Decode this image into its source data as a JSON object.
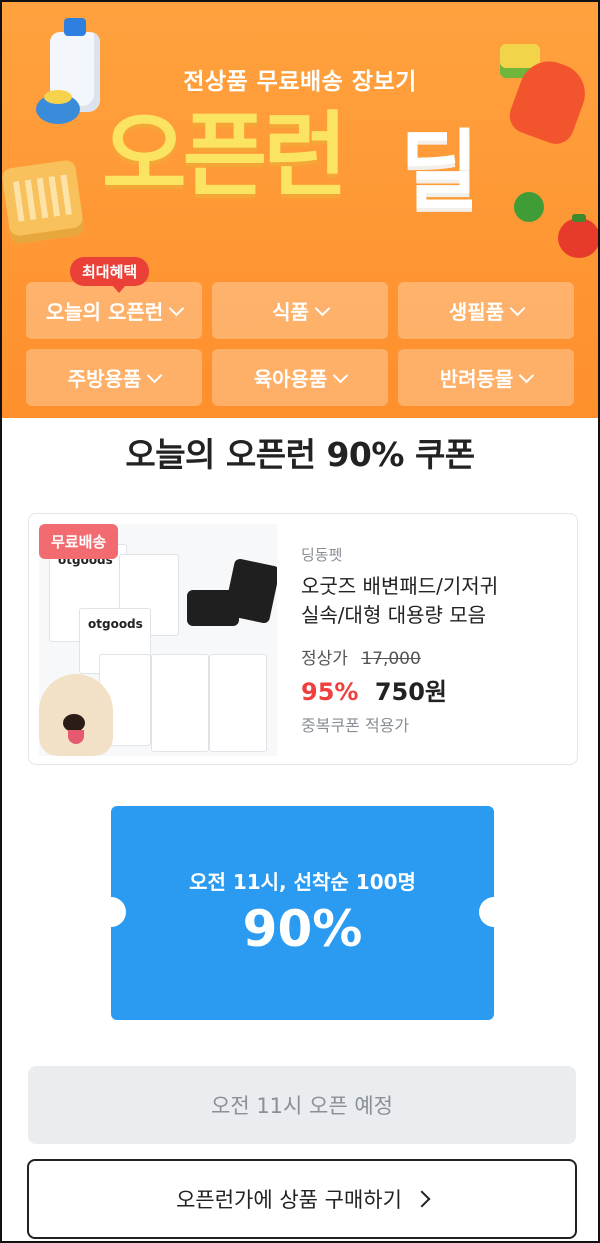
{
  "banner": {
    "subtitle": "전상품 무료배송 장보기",
    "title_main": "오픈런",
    "title_suffix": "딜",
    "badge": "최대혜택",
    "bg_color": "#fe9a35"
  },
  "categories": [
    {
      "label": "오늘의 오픈런",
      "icon": "chevron-down-icon"
    },
    {
      "label": "식품",
      "icon": "chevron-down-icon"
    },
    {
      "label": "생필품",
      "icon": "chevron-down-icon"
    },
    {
      "label": "주방용품",
      "icon": "chevron-down-icon"
    },
    {
      "label": "육아용품",
      "icon": "chevron-down-icon"
    },
    {
      "label": "반려동물",
      "icon": "chevron-down-icon"
    }
  ],
  "section": {
    "title": "오늘의 오픈런 90% 쿠폰"
  },
  "product": {
    "tag": "무료배송",
    "brand": "딩동펫",
    "name_line1": "오굿즈 배변패드/기저귀",
    "name_line2": "실속/대형 대용량 모음",
    "original_label": "정상가",
    "original_price": "17,000",
    "discount": "95%",
    "price": "750원",
    "note": "중복쿠폰 적용가",
    "image_logo": "otgoods",
    "tag_color": "#f26b70",
    "discount_color": "#ef3f3f"
  },
  "coupon": {
    "subtitle": "오전 11시, 선착순 100명",
    "value": "90%",
    "color": "#2a9bf0"
  },
  "buttons": {
    "disabled_label": "오전 11시 오픈 예정",
    "buy_label": "오픈런가에 상품 구매하기",
    "buy_icon": "chevron-right-icon"
  }
}
